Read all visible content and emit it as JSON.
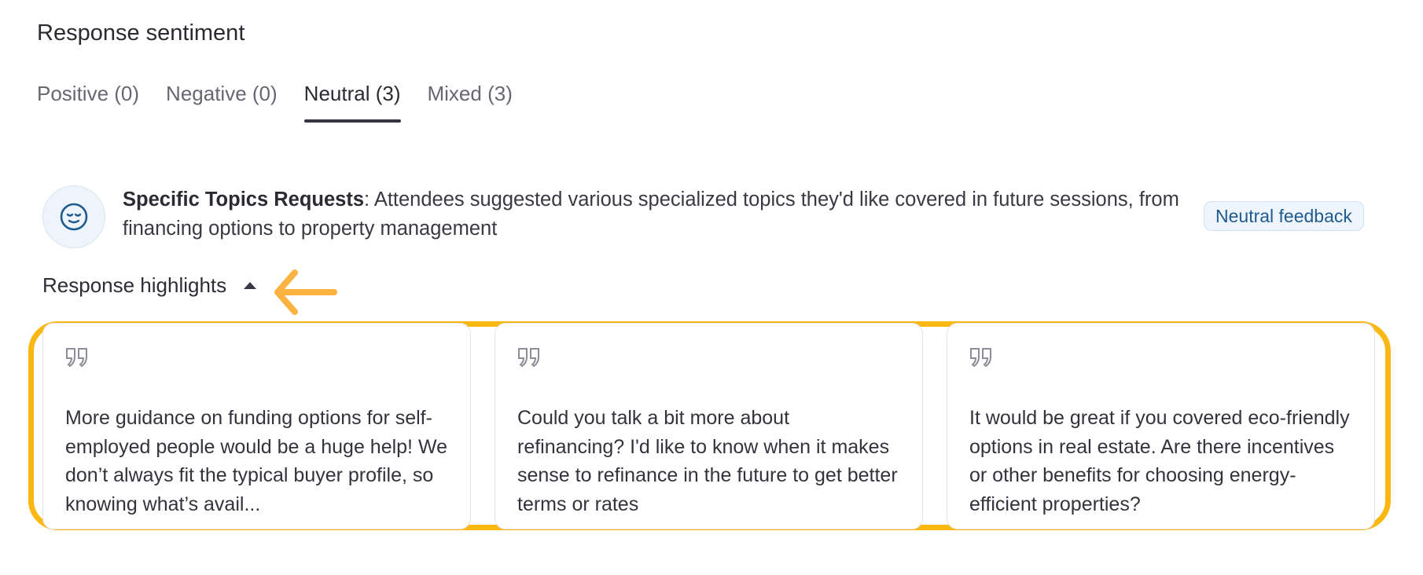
{
  "section": {
    "title": "Response sentiment"
  },
  "tabs": [
    {
      "label": "Positive (0)",
      "active": false
    },
    {
      "label": "Negative (0)",
      "active": false
    },
    {
      "label": "Neutral (3)",
      "active": true
    },
    {
      "label": "Mixed (3)",
      "active": false
    }
  ],
  "summary": {
    "icon": "neutral-face-icon",
    "topic": "Specific Topics Requests",
    "separator": ":",
    "text": " Attendees suggested various specialized topics they'd like covered in future sessions, from financing options to property management",
    "badge": "Neutral feedback"
  },
  "highlights": {
    "label": "Response highlights",
    "toggle_icon": "caret-up-icon",
    "quotes": [
      {
        "icon": "quote-icon",
        "text": "More guidance on funding options for self-employed people would be a huge help! We don’t always fit the typical buyer profile, so knowing what’s avail..."
      },
      {
        "icon": "quote-icon",
        "text": "Could you talk a bit more about refinancing? I'd like to know when it makes sense to refinance in the future to get better terms or rates"
      },
      {
        "icon": "quote-icon",
        "text": "It would be great if you covered eco-friendly options in real estate. Are there incentives or other benefits for choosing energy-efficient properties?"
      }
    ]
  },
  "colors": {
    "accent_highlight": "#fbb813",
    "annotation_arrow": "#fbb23f",
    "badge_text": "#1f5a8f",
    "active_tab_underline": "#38343f"
  }
}
